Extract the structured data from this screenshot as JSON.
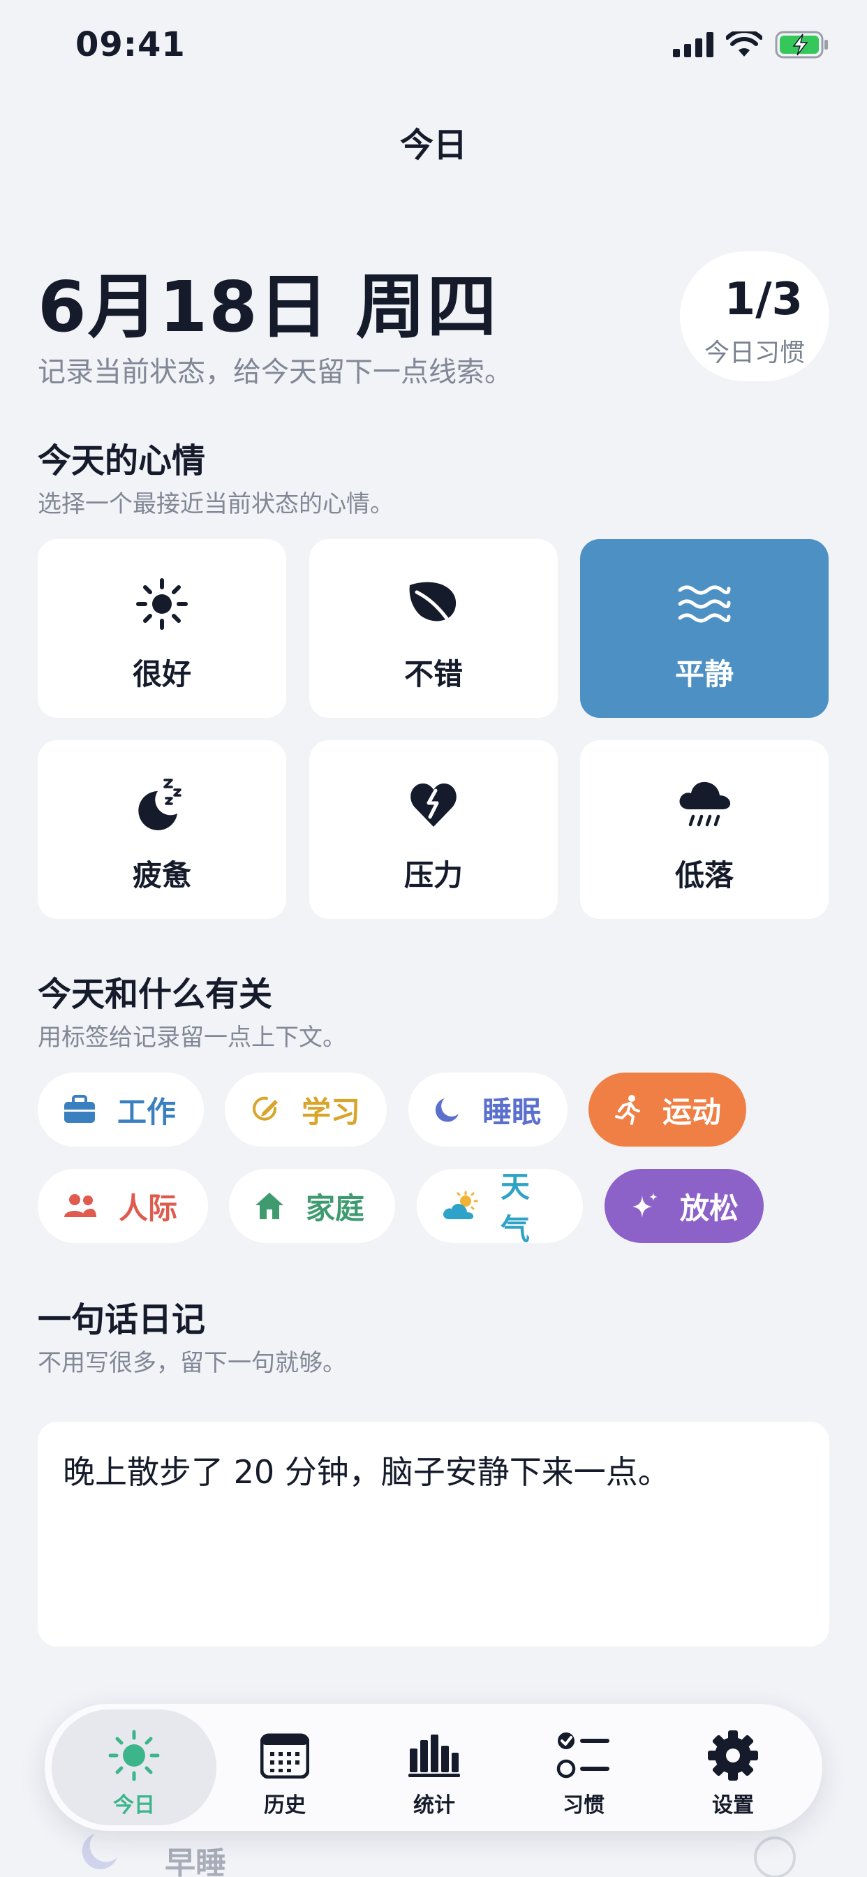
{
  "status": {
    "time": "09:41",
    "icons": [
      "signal-icon",
      "wifi-icon",
      "battery-charging-icon"
    ]
  },
  "nav": {
    "title": "今日"
  },
  "header": {
    "date": "6月18日 周四",
    "subtitle": "记录当前状态，给今天留下一点线索。"
  },
  "habit_badge": {
    "value": "1/3",
    "label": "今日习惯"
  },
  "mood": {
    "title": "今天的心情",
    "subtitle": "选择一个最接近当前状态的心情。",
    "selected": "平静",
    "options": [
      {
        "label": "很好",
        "icon": "sun-icon"
      },
      {
        "label": "不错",
        "icon": "leaf-icon"
      },
      {
        "label": "平静",
        "icon": "waves-icon"
      },
      {
        "label": "疲惫",
        "icon": "moon-sleep-icon"
      },
      {
        "label": "压力",
        "icon": "broken-heart-icon"
      },
      {
        "label": "低落",
        "icon": "rain-cloud-icon"
      }
    ]
  },
  "tags": {
    "title": "今天和什么有关",
    "subtitle": "用标签给记录留一点上下文。",
    "items": [
      {
        "label": "工作",
        "icon": "briefcase-icon",
        "color": "#3a7fbf",
        "selected": false
      },
      {
        "label": "学习",
        "icon": "pencil-circle-icon",
        "color": "#d9a42a",
        "selected": false
      },
      {
        "label": "睡眠",
        "icon": "moon-icon",
        "color": "#5b6fcf",
        "selected": false
      },
      {
        "label": "运动",
        "icon": "running-icon",
        "color": "#f07f45",
        "selected": true
      },
      {
        "label": "人际",
        "icon": "people-icon",
        "color": "#e05b4e",
        "selected": false
      },
      {
        "label": "家庭",
        "icon": "house-icon",
        "color": "#3f9b6f",
        "selected": false
      },
      {
        "label": "天气",
        "icon": "sun-cloud-icon",
        "color": "#2fa3c7",
        "selected": false
      },
      {
        "label": "放松",
        "icon": "sparkle-icon",
        "color": "#8c62c9",
        "selected": true
      }
    ]
  },
  "journal": {
    "title": "一句话日记",
    "subtitle": "不用写很多，留下一句就够。",
    "value": "晚上散步了 20 分钟，脑子安静下来一点。"
  },
  "habits_peek": {
    "first_habit": "早睡"
  },
  "tabbar": {
    "active": "今日",
    "tabs": [
      {
        "label": "今日",
        "icon": "sun-icon"
      },
      {
        "label": "历史",
        "icon": "calendar-icon"
      },
      {
        "label": "统计",
        "icon": "bar-chart-icon"
      },
      {
        "label": "习惯",
        "icon": "checklist-icon"
      },
      {
        "label": "设置",
        "icon": "gear-icon"
      }
    ]
  }
}
